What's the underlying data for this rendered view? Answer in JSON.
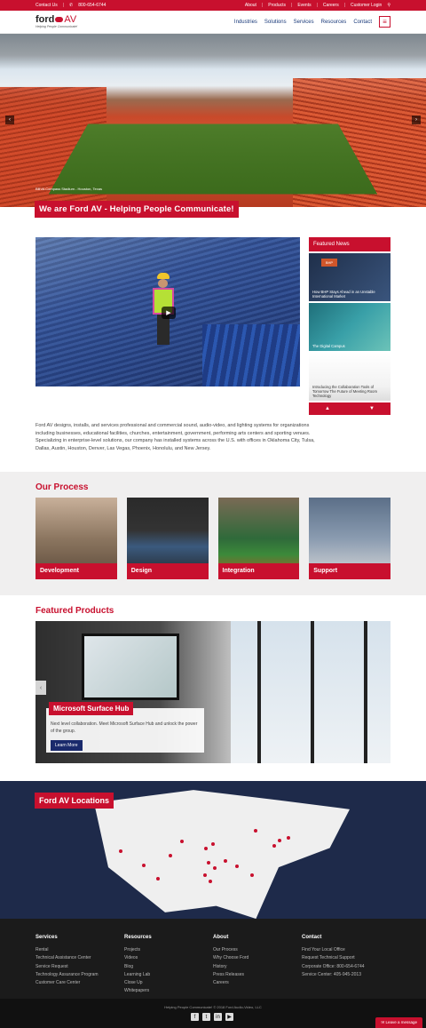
{
  "topbar": {
    "contact": "Contact Us",
    "phone": "800-654-6744",
    "links": [
      "About",
      "Products",
      "Events",
      "Careers",
      "Customer Login"
    ]
  },
  "header": {
    "logo_text": "ford",
    "logo_av": "AV",
    "tagline": "Helping People Communicate!",
    "nav": [
      "Industries",
      "Solutions",
      "Services",
      "Resources",
      "Contact"
    ]
  },
  "hero": {
    "photo_caption": "BBVA Compass Stadium - Houston, Texas",
    "banner": "We are Ford AV - Helping People Communicate!"
  },
  "news": {
    "title": "Featured News",
    "items": [
      "How BHP Stays Ahead in an Unstable International Market",
      "The Digital Campus",
      "Introducing the Collaboration Tools of Tomorrow The Future of Meeting Room Technology"
    ],
    "bhp_logo": "BHP"
  },
  "intro": {
    "text": "Ford AV designs, installs, and services professional and commercial sound, audio-video, and lighting systems for organizations including businesses, educational facilities, churches, entertainment, government, performing arts centers and sporting venues. Specializing in enterprise-level solutions, our company has installed systems across the U.S. with offices in Oklahoma City, Tulsa, Dallas, Austin, Houston, Denver, Las Vegas, Phoenix, Honolulu, and New Jersey."
  },
  "process": {
    "title": "Our Process",
    "cards": [
      "Development",
      "Design",
      "Integration",
      "Support"
    ]
  },
  "products": {
    "title": "Featured Products",
    "item_title": "Microsoft Surface Hub",
    "item_text": "Next level collaboration. Meet Microsoft Surface Hub and unlock the power of the group.",
    "button": "Learn More"
  },
  "locations": {
    "title": "Ford AV Locations"
  },
  "footer": {
    "cols": [
      {
        "title": "Services",
        "items": [
          "Rental",
          "Technical Assistance Center",
          "Service Request",
          "Technology Assurance Program",
          "Customer Care Center"
        ]
      },
      {
        "title": "Resources",
        "items": [
          "Projects",
          "Videos",
          "Blog",
          "Learning Lab",
          "Close Up",
          "Whitepapers"
        ]
      },
      {
        "title": "About",
        "items": [
          "Our Process",
          "Why Choose Ford",
          "History",
          "Press Releases",
          "Careers"
        ]
      },
      {
        "title": "Contact",
        "items": [
          "Find Your Local Office",
          "Request Technical Support",
          "Corporate Office: 800-654-6744",
          "Service Center: 405-945-2013"
        ]
      }
    ],
    "copyright": "Helping People Communicate! © 2018 Ford Audio-Video, LLC",
    "chat": "Leave a message"
  },
  "colors": {
    "accent": "#c8102e",
    "navy": "#1a2a6c"
  }
}
